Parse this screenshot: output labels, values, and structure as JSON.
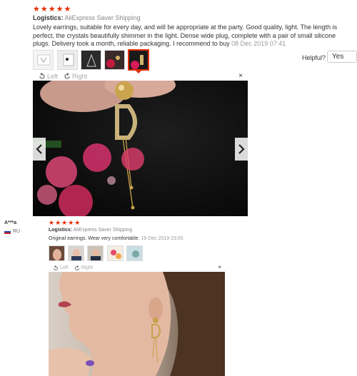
{
  "review1": {
    "stars": "★★★★★",
    "logistics_label": "Logistics:",
    "logistics_value": "AliExpress Saver Shipping",
    "text": "Lovely earrings, suitable for every day, and will be appropriate at the party. Good quality, light. The length is perfect, the crystals beautifully shimmer in the light. Dense wide plug, complete with a pair of small silicone plugs. Delivery took a month, reliable packaging. I recommend to buy",
    "date": "08 Dec 2019 07:41",
    "helpful_label": "Helpful?",
    "helpful_yes": "Yes",
    "viewer": {
      "left": "Left",
      "right": "Right",
      "close": "×"
    }
  },
  "review2": {
    "user_name": "A***a",
    "country": "RU",
    "stars": "★★★★★",
    "logistics_label": "Logistics:",
    "logistics_value": "AliExpress Saver Shipping",
    "text": "Original earrings. Wear very comfortable.",
    "date": "19 Dec 2019 23:05",
    "viewer": {
      "left": "Left",
      "right": "Right",
      "close": "×"
    }
  },
  "colors": {
    "star": "#e62e04",
    "selected_border": "#e62e04"
  },
  "icons": [
    "rotate-left-icon",
    "rotate-right-icon",
    "close-icon",
    "chevron-left-icon",
    "chevron-right-icon",
    "russia-flag-icon"
  ]
}
